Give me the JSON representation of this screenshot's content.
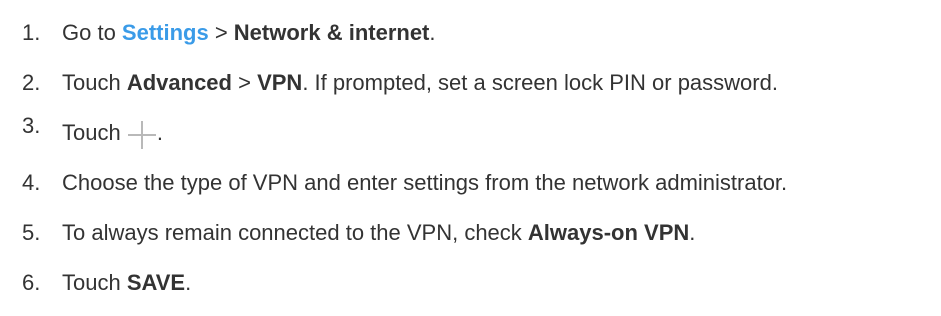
{
  "steps": [
    {
      "number": "1.",
      "parts": {
        "t1": "Go to ",
        "settings_link": "Settings",
        "t2": " > ",
        "b1": "Network & internet",
        "t3": "."
      }
    },
    {
      "number": "2.",
      "parts": {
        "t1": "Touch ",
        "b1": "Advanced",
        "t2": " > ",
        "b2": "VPN",
        "t3": ". If prompted, set a screen lock PIN or password."
      }
    },
    {
      "number": "3.",
      "parts": {
        "t1": "Touch ",
        "icon": "plus-icon",
        "t2": "."
      }
    },
    {
      "number": "4.",
      "parts": {
        "t1": "Choose the type of VPN and enter settings from the network administrator."
      }
    },
    {
      "number": "5.",
      "parts": {
        "t1": "To always remain connected to the VPN, check ",
        "b1": "Always-on VPN",
        "t2": "."
      }
    },
    {
      "number": "6.",
      "parts": {
        "t1": "Touch ",
        "b1": "SAVE",
        "t2": "."
      }
    }
  ],
  "colors": {
    "text": "#333333",
    "link": "#3a9be8",
    "icon": "#b9b9b9"
  }
}
